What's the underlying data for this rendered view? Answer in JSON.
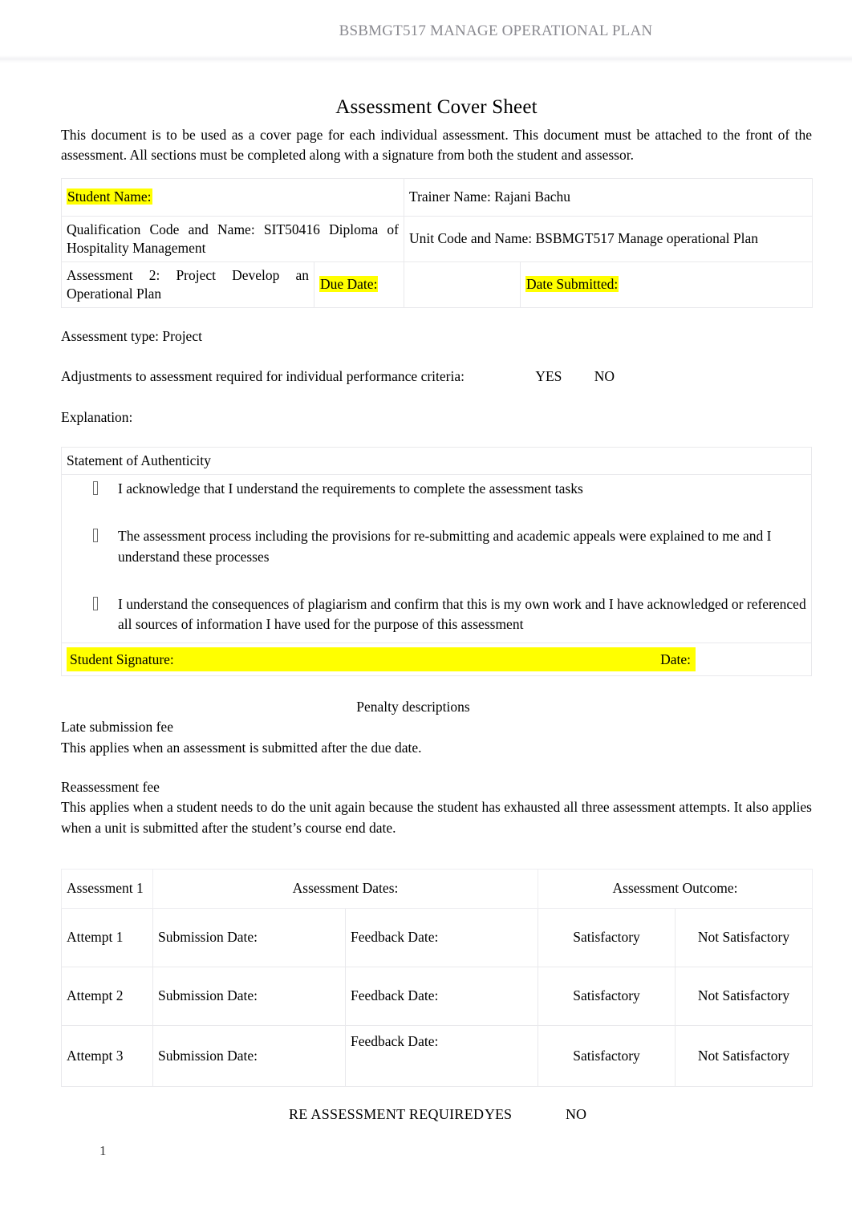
{
  "header": {
    "running_title": "BSBMGT517 MANAGE OPERATIONAL PLAN"
  },
  "document": {
    "title": "Assessment Cover Sheet",
    "intro": "This document is to be used as a cover page for each individual assessment. This document must be attached to the front of the assessment.    All sections must be completed along with a signature from both the student and assessor."
  },
  "identity_table": {
    "student_name_label": "Student Name:",
    "trainer_name": "Trainer Name: Rajani Bachu",
    "qualification": "Qualification Code and Name: SIT50416 Diploma of Hospitality Management",
    "unit": "Unit Code and Name: BSBMGT517 Manage operational Plan",
    "assessment": "Assessment 2: Project Develop an Operational Plan",
    "due_date_label": "Due Date:",
    "due_date_value": "",
    "date_submitted_label": "Date Submitted:",
    "date_submitted_value": ""
  },
  "details": {
    "assessment_type": "Assessment type: Project",
    "adjustments_label": "Adjustments to assessment required for individual performance criteria:",
    "yes": "YES",
    "no": "NO",
    "explanation_label": "Explanation:"
  },
  "authenticity": {
    "heading": "Statement of Authenticity",
    "bullets": [
      "I acknowledge that I understand the requirements to complete the assessment tasks",
      "The assessment process including the provisions for re-submitting and academic appeals were explained to me and I understand these processes",
      "I understand the consequences of plagiarism and confirm that this is my own work and I have acknowledged or referenced all sources of information I have used for the purpose of this assessment"
    ],
    "student_signature_label": "Student Signature:",
    "date_label": "Date:"
  },
  "penalties": {
    "heading": "Penalty descriptions",
    "late_title": "Late submission fee",
    "late_text": "This applies when an assessment is submitted after the due date.",
    "reassessment_title": "Reassessment fee",
    "reassessment_text": "This applies when a student needs to do the unit again because the student has exhausted all three assessment attempts. It also applies when a unit is submitted after the student’s course end date."
  },
  "attempts_table": {
    "headers": {
      "assessment": "Assessment 1",
      "dates": "Assessment Dates:",
      "outcome": "Assessment Outcome:"
    },
    "rows": [
      {
        "attempt": "Attempt 1",
        "submission_date": "Submission Date:",
        "feedback_date": "Feedback Date:",
        "satisfactory": "Satisfactory",
        "not_satisfactory": "Not Satisfactory"
      },
      {
        "attempt": "Attempt 2",
        "submission_date": "Submission Date:",
        "feedback_date": "Feedback Date:",
        "satisfactory": "Satisfactory",
        "not_satisfactory": "Not Satisfactory"
      },
      {
        "attempt": "Attempt 3",
        "submission_date": "Submission Date:",
        "feedback_date": "Feedback Date:",
        "satisfactory": "Satisfactory",
        "not_satisfactory": "Not Satisfactory"
      }
    ]
  },
  "reassessment_line": {
    "label": "RE ASSESSMENT REQUIRED",
    "yes": "YES",
    "no": "NO"
  },
  "footer": {
    "page_number": "1"
  },
  "colors": {
    "highlight": "#ffff00",
    "header_text": "#8a8a90",
    "table_border": "#e9e9ec"
  }
}
